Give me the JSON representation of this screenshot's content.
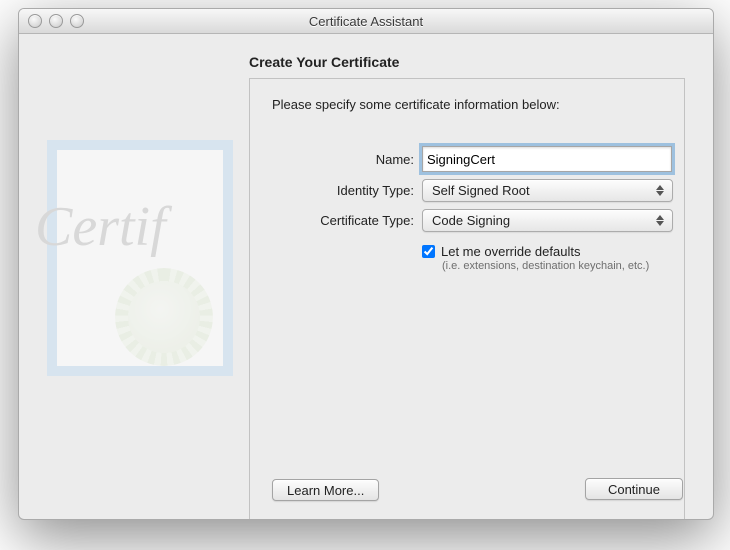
{
  "window": {
    "title": "Certificate Assistant"
  },
  "heading": "Create Your Certificate",
  "instruction": "Please specify some certificate information below:",
  "labels": {
    "name": "Name:",
    "identity": "Identity Type:",
    "certType": "Certificate Type:"
  },
  "fields": {
    "name": "SigningCert",
    "identity": "Self Signed Root",
    "certType": "Code Signing"
  },
  "override": {
    "checked": true,
    "label": "Let me override defaults",
    "hint": "(i.e. extensions, destination keychain, etc.)"
  },
  "buttons": {
    "learn": "Learn More...",
    "continue": "Continue"
  },
  "bg": {
    "script": "Certif"
  }
}
